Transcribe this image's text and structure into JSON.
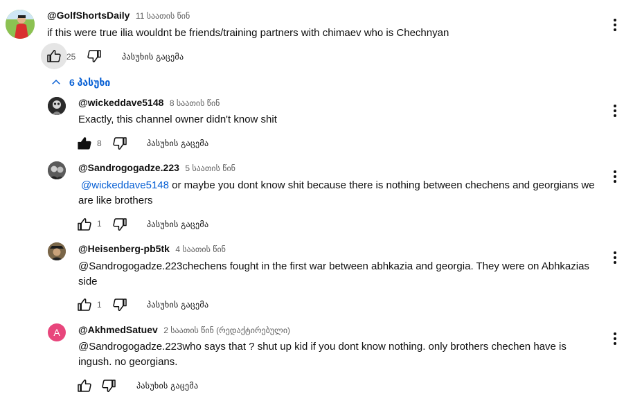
{
  "top_comment": {
    "author": "@GolfShortsDaily",
    "time": "11 საათის წინ",
    "text": "if this were true ilia wouldnt be friends/training partners with chimaev who is Chechnyan",
    "likes": "25",
    "reply_label": "პასუხის გაცემა"
  },
  "replies_toggle": {
    "label": "6 პასუხი"
  },
  "replies": [
    {
      "author": "@wickeddave5148",
      "time": "8 საათის წინ",
      "text": "Exactly, this channel owner didn't know shit",
      "likes": "8",
      "reply_label": "პასუხის გაცემა"
    },
    {
      "author": "@Sandrogogadze.223",
      "time": "5 საათის წინ",
      "mention": "@wickeddave5148",
      "text": " or maybe you dont know shit because there is nothing between chechens and georgians we are like brothers",
      "likes": "1",
      "reply_label": "პასუხის გაცემა"
    },
    {
      "author": "@Heisenberg-pb5tk",
      "time": "4 საათის წინ",
      "text": "@Sandrogogadze.223chechens fought in the first war between abhkazia and georgia. They were on Abhkazias side",
      "likes": "1",
      "reply_label": "პასუხის გაცემა"
    },
    {
      "author": "@AkhmedSatuev",
      "time": "2 საათის წინ (რედაქტირებული)",
      "avatar_letter": "A",
      "text": "@Sandrogogadze.223who says that ? shut up kid if you dont know nothing. only brothers chechen have is ingush. no georgians.",
      "reply_label": "პასუხის გაცემა"
    }
  ],
  "colors": {
    "link": "#065fd4",
    "meta": "#606060",
    "avatar_letter_bg": "#e8467c"
  }
}
